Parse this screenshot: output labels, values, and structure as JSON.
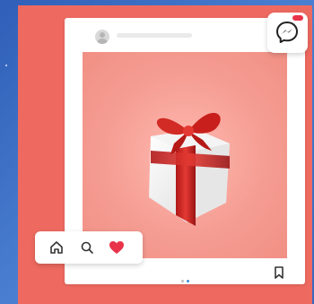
{
  "colors": {
    "poster_bg": "#ee6a60",
    "card_bg": "#ffffff",
    "heart": "#e8334a",
    "dot_active": "#3b8ed8",
    "dot_inactive": "#bfbfbf"
  },
  "post": {
    "icon_names": [
      "avatar-icon",
      "gift-box-illustration"
    ]
  },
  "action_bar": {
    "icons": [
      "home-icon",
      "search-icon",
      "heart-icon"
    ]
  },
  "carousel": {
    "total_dots": 2,
    "active_index": 0
  },
  "messenger": {
    "icon": "messenger-icon"
  }
}
